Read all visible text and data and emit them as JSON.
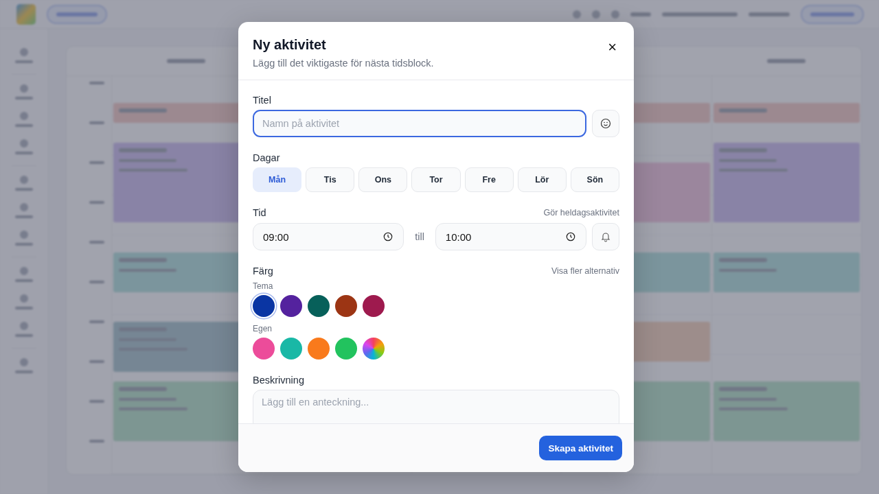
{
  "dialog": {
    "title": "Ny aktivitet",
    "subtitle": "Lägg till det viktigaste för nästa tidsblock.",
    "close": "×",
    "title_field": {
      "label": "Titel",
      "placeholder": "Namn på aktivitet"
    },
    "days": {
      "label": "Dagar",
      "items": [
        {
          "label": "Mån",
          "selected": true
        },
        {
          "label": "Tis",
          "selected": false
        },
        {
          "label": "Ons",
          "selected": false
        },
        {
          "label": "Tor",
          "selected": false
        },
        {
          "label": "Fre",
          "selected": false
        },
        {
          "label": "Lör",
          "selected": false
        },
        {
          "label": "Sön",
          "selected": false
        }
      ]
    },
    "time": {
      "label": "Tid",
      "all_day_link": "Gör heldagsaktivitet",
      "from": "09:00",
      "separator": "till",
      "to": "10:00"
    },
    "color": {
      "label": "Färg",
      "more_link": "Visa fler alternativ",
      "theme": {
        "label": "Tema",
        "swatches": [
          {
            "color": "#0a35a3",
            "selected": true
          },
          {
            "color": "#54229e",
            "selected": false
          },
          {
            "color": "#07605a",
            "selected": false
          },
          {
            "color": "#9c3514",
            "selected": false
          },
          {
            "color": "#9e1a4e",
            "selected": false
          }
        ]
      },
      "custom": {
        "label": "Egen",
        "swatches": [
          {
            "kind": "solid",
            "color": "#ec4c9a"
          },
          {
            "kind": "solid",
            "color": "#19b8a6"
          },
          {
            "kind": "solid",
            "color": "#f97a1c"
          },
          {
            "kind": "solid",
            "color": "#22c35e"
          },
          {
            "kind": "spectrum"
          }
        ]
      }
    },
    "description": {
      "label": "Beskrivning",
      "placeholder": "Lägg till en anteckning..."
    },
    "submit": "Skapa aktivitet"
  }
}
